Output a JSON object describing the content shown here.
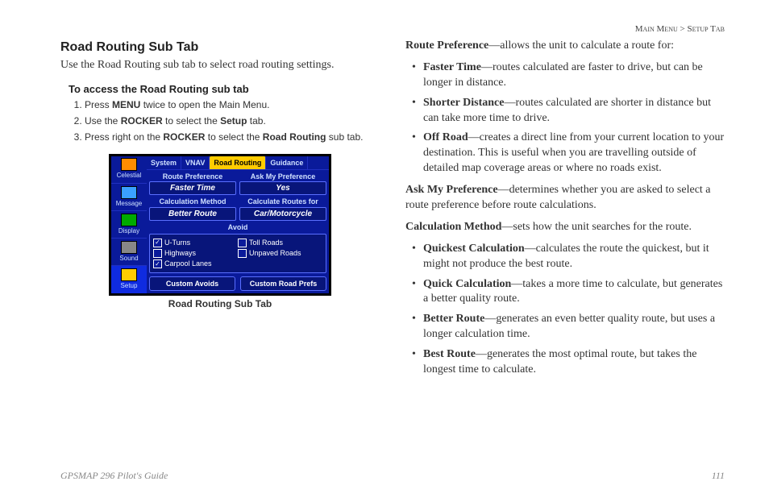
{
  "header": {
    "path_left": "Main Menu",
    "path_sep": " > ",
    "path_right": "Setup Tab"
  },
  "left": {
    "title": "Road Routing Sub Tab",
    "intro": "Use the Road Routing sub tab to select road routing settings.",
    "access_title": "To access the Road Routing sub tab",
    "steps": {
      "s1a": "Press ",
      "s1b": "MENU",
      "s1c": " twice to open the Main Menu.",
      "s2a": "Use the ",
      "s2b": "ROCKER",
      "s2c": " to select the ",
      "s2d": "Setup",
      "s2e": " tab.",
      "s3a": "Press right on the ",
      "s3b": "ROCKER",
      "s3c": " to select the ",
      "s3d": "Road Routing",
      "s3e": " sub tab."
    },
    "device": {
      "side": {
        "celestial": "Celestial",
        "message": "Message",
        "display": "Display",
        "sound": "Sound",
        "setup": "Setup"
      },
      "tabs": {
        "system": "System",
        "vnav": "VNAV",
        "road_routing": "Road Routing",
        "guidance": "Guidance"
      },
      "labels": {
        "route_pref": "Route Preference",
        "ask_pref": "Ask My Preference",
        "calc_method": "Calculation Method",
        "calc_for": "Calculate Routes for",
        "avoid": "Avoid"
      },
      "values": {
        "route_pref": "Faster Time",
        "ask_pref": "Yes",
        "calc_method": "Better Route",
        "calc_for": "Car/Motorcycle"
      },
      "avoid": {
        "uturns": "U-Turns",
        "highways": "Highways",
        "carpool": "Carpool Lanes",
        "toll": "Toll Roads",
        "unpaved": "Unpaved Roads"
      },
      "buttons": {
        "custom_avoids": "Custom Avoids",
        "custom_prefs": "Custom Road Prefs"
      }
    },
    "caption": "Road Routing Sub Tab"
  },
  "right": {
    "rp_label": "Route Preference",
    "rp_text": "—allows the unit to calculate a route for:",
    "rp_items": {
      "ft_label": "Faster Time",
      "ft_text": "—routes calculated are faster to drive, but can be longer in distance.",
      "sd_label": "Shorter Distance",
      "sd_text": "—routes calculated are shorter in distance but can take more time to drive.",
      "or_label": "Off Road",
      "or_text": "—creates a direct line from your current location to your destination. This is useful when you are travelling outside of detailed map coverage areas or where no roads exist."
    },
    "amp_label": "Ask My Preference",
    "amp_text": "—determines whether you are asked to select a route preference before route calculations.",
    "cm_label": "Calculation Method",
    "cm_text": "—sets how the unit searches for the route.",
    "cm_items": {
      "qc_label": "Quickest Calculation",
      "qc_text": "—calculates the route the quickest, but it might not produce the best route.",
      "qk_label": "Quick Calculation",
      "qk_text": "—takes a more time to calculate, but generates a better quality route.",
      "br_label": "Better Route",
      "br_text": "—generates an even better quality route, but uses a longer calculation time.",
      "best_label": "Best Route",
      "best_text": "—generates the most optimal route, but takes the longest time to calculate."
    }
  },
  "footer": {
    "guide": "GPSMAP 296 Pilot's Guide",
    "page": "111"
  }
}
